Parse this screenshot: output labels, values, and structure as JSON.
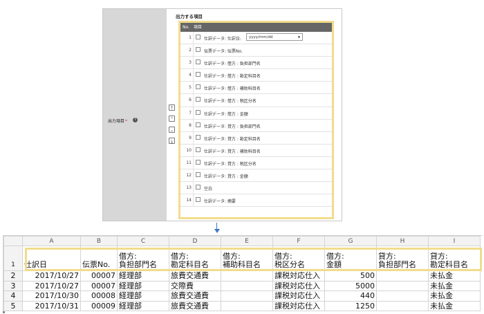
{
  "panel": {
    "field_label": "出力項目",
    "required_mark": "*",
    "help_icon": "?",
    "section_title": "出力する項目",
    "header_no": "No.",
    "header_item": "項目",
    "move_buttons": [
      "⤒",
      "⌃",
      "⌄",
      "⤓"
    ],
    "items": [
      {
        "no": "1",
        "label": "仕訳データ: 仕訳日:",
        "select_value": "yyyy/mm/dd"
      },
      {
        "no": "2",
        "label": "伝票データ: 伝票No."
      },
      {
        "no": "3",
        "label": "仕訳データ: 借方 : 負担部門名"
      },
      {
        "no": "4",
        "label": "仕訳データ: 借方 : 勘定科目名"
      },
      {
        "no": "5",
        "label": "仕訳データ: 借方 : 補助科目名"
      },
      {
        "no": "6",
        "label": "仕訳データ: 借方 : 税区分名"
      },
      {
        "no": "7",
        "label": "仕訳データ: 借方 : 金額"
      },
      {
        "no": "8",
        "label": "仕訳データ: 貸方 : 負担部門名"
      },
      {
        "no": "9",
        "label": "仕訳データ: 貸方 : 勘定科目名"
      },
      {
        "no": "10",
        "label": "仕訳データ: 貸方 : 補助科目名"
      },
      {
        "no": "11",
        "label": "仕訳データ: 貸方 : 税区分名"
      },
      {
        "no": "12",
        "label": "仕訳データ: 貸方 : 金額"
      },
      {
        "no": "13",
        "label": "空白"
      },
      {
        "no": "14",
        "label": "仕訳データ: 摘要"
      }
    ]
  },
  "sheet": {
    "columns": [
      "A",
      "B",
      "C",
      "D",
      "E",
      "F",
      "G",
      "H",
      "I"
    ],
    "rows": [
      "1",
      "2",
      "3",
      "4",
      "5"
    ],
    "header": [
      "仕訳日",
      "伝票No.",
      "借方:\n負担部門名",
      "借方:\n勘定科目名",
      "借方:\n補助科目名",
      "借方:\n税区分名",
      "借方:\n金額",
      "貸方:\n負担部門名",
      "貸方:\n勘定科目名"
    ],
    "data": [
      [
        "2017/10/27",
        "00007",
        "経理部",
        "旅費交通費",
        "",
        "課税対応仕入",
        "500",
        "",
        "未払金"
      ],
      [
        "2017/10/27",
        "00007",
        "経理部",
        "交際費",
        "",
        "課税対応仕入",
        "5000",
        "",
        "未払金"
      ],
      [
        "2017/10/30",
        "00008",
        "経理部",
        "旅費交通費",
        "",
        "課税対応仕入",
        "440",
        "",
        "未払金"
      ],
      [
        "2017/10/31",
        "00009",
        "経理部",
        "旅費交通費",
        "",
        "課税対応仕入",
        "1250",
        "",
        "未払金"
      ]
    ]
  },
  "colors": {
    "highlight": "#f1dc8c",
    "arrow": "#3b78c2",
    "label_bg": "#d7d7d7",
    "header_bg": "#666666"
  }
}
